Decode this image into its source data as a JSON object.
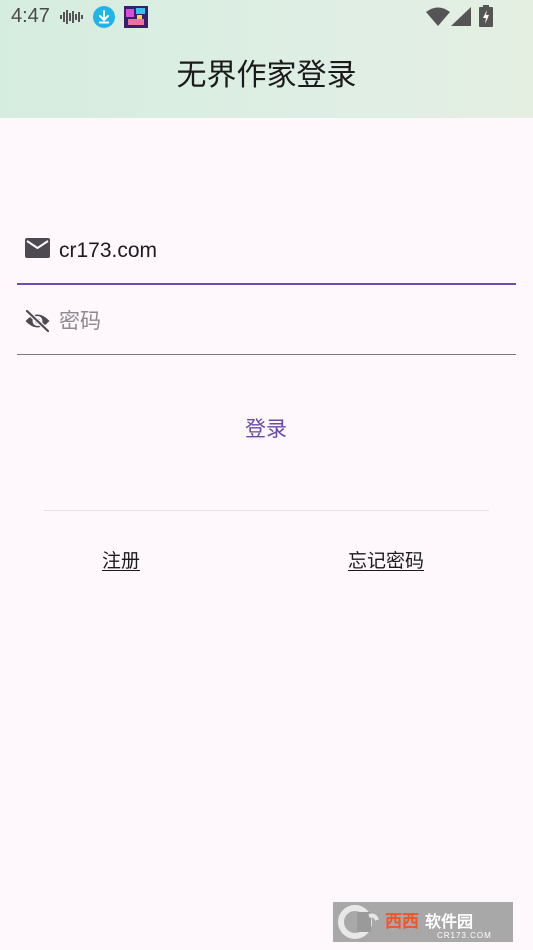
{
  "status_bar": {
    "time": "4:47",
    "icons": [
      "audio-wave-icon",
      "download-icon",
      "game-thumbnail-icon",
      "wifi-icon",
      "signal-icon",
      "battery-icon"
    ]
  },
  "header": {
    "title": "无界作家登录"
  },
  "form": {
    "email": {
      "icon": "email-icon",
      "value": "cr173.com"
    },
    "password": {
      "icon": "visibility-off-icon",
      "placeholder": "密码",
      "value": ""
    },
    "login_label": "登录"
  },
  "links": {
    "register": "注册",
    "forgot_password": "忘记密码"
  },
  "watermark": {
    "brand": "西西软件园",
    "site": "CR173.COM"
  },
  "colors": {
    "accent": "#6f4fad",
    "background": "#fef8fd",
    "header_bg": "#d9eee2"
  }
}
